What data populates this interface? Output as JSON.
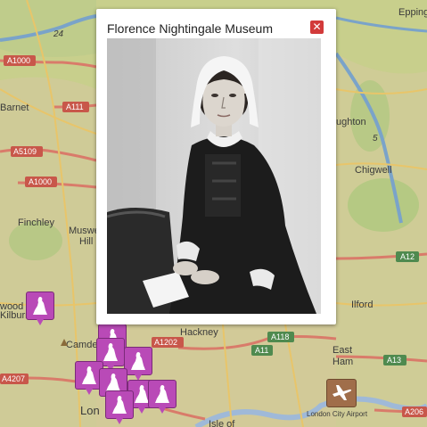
{
  "map": {
    "places": {
      "epping": "Epping",
      "barnet": "Barnet",
      "loughton": "ughton",
      "chigwell": "Chigwell",
      "finchley": "Finchley",
      "muswell": "Muswell",
      "hill": "Hill",
      "wood": "wood",
      "kilburn": "Kilburn",
      "camden": "Camde",
      "hackney": "Hackney",
      "ilford": "Ilford",
      "east": "East",
      "ham": "Ham",
      "isle": "Isle of",
      "london": "Lon",
      "airport": "London City Airport"
    },
    "roads": {
      "a1000_top": "A1000",
      "a111": "A111",
      "a5109": "A5109",
      "a1000_mid": "A1000",
      "a12": "A12",
      "a1202": "A1202",
      "a118": "A118",
      "a11": "A11",
      "a13": "A13",
      "a4207": "A4207",
      "a206": "A206",
      "m24": "24",
      "m5": "5"
    },
    "colors": {
      "base": "#c9d18f",
      "urban": "#d9c9a4",
      "road_major": "#d97b6a",
      "road_secondary": "#e8c56a",
      "motorway": "#7aa3c9",
      "marker": "#b94ab7",
      "airport_marker": "#a06e4a"
    }
  },
  "popup": {
    "title": "Florence Nightingale Museum",
    "close_icon": "close-icon",
    "image_subject": "portrait-image"
  },
  "markers": {
    "icon": "statue-icon",
    "count": 10,
    "airport_icon": "airplane-icon"
  }
}
